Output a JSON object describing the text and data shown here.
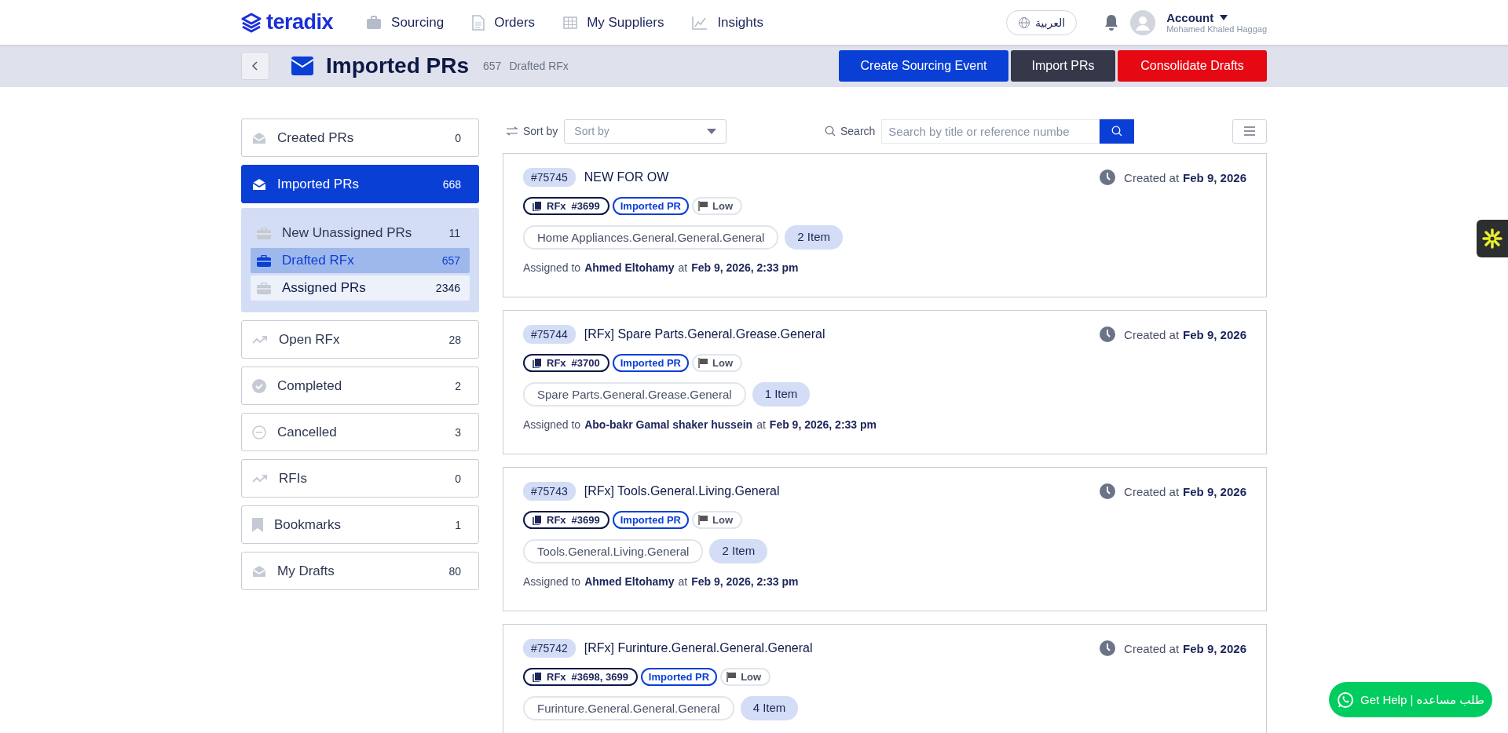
{
  "header": {
    "logo": "teradix",
    "nav": [
      {
        "kind": "briefcase",
        "label": "Sourcing"
      },
      {
        "kind": "document",
        "label": "Orders"
      },
      {
        "kind": "grid",
        "label": "My Suppliers"
      },
      {
        "kind": "chart",
        "label": "Insights"
      }
    ],
    "language": "العربية",
    "account": {
      "label": "Account",
      "name": "Mohamed Khaled Haggag"
    }
  },
  "page": {
    "title": "Imported PRs",
    "count": "657",
    "subtitle": "Drafted RFx",
    "actions": [
      {
        "kind": "primary",
        "label": "Create Sourcing Event"
      },
      {
        "kind": "dark",
        "label": "Import PRs"
      },
      {
        "kind": "danger",
        "label": "Consolidate Drafts"
      }
    ]
  },
  "sidebar": {
    "items": [
      {
        "kind": "inbox",
        "label": "Created PRs",
        "count": "0",
        "selected": false
      },
      {
        "kind": "inbox",
        "label": "Imported PRs",
        "count": "668",
        "selected": true,
        "expanded": true,
        "children": [
          {
            "label": "New Unassigned PRs",
            "count": "11",
            "selected": false,
            "hovered": false
          },
          {
            "label": "Drafted RFx",
            "count": "657",
            "selected": true,
            "hovered": false
          },
          {
            "label": "Assigned PRs",
            "count": "2346",
            "selected": false,
            "hovered": true
          }
        ]
      },
      {
        "kind": "trend",
        "label": "Open RFx",
        "count": "28",
        "selected": false
      },
      {
        "kind": "check",
        "label": "Completed",
        "count": "2",
        "selected": false
      },
      {
        "kind": "cancel",
        "label": "Cancelled",
        "count": "3",
        "selected": false
      },
      {
        "kind": "trend",
        "label": "RFIs",
        "count": "0",
        "selected": false
      },
      {
        "kind": "bookmark",
        "label": "Bookmarks",
        "count": "1",
        "selected": false
      },
      {
        "kind": "inbox",
        "label": "My Drafts",
        "count": "80",
        "selected": false
      }
    ]
  },
  "toolbar": {
    "sort_label": "Sort by",
    "sort_placeholder": "Sort by",
    "search_label": "Search",
    "search_placeholder": "Search by title or reference numbe"
  },
  "cards": [
    {
      "id": "#75745",
      "title": "NEW FOR OW",
      "rfx_label": "RFx",
      "rfx": "#3699",
      "tag": "Imported PR",
      "priority": "Low",
      "category": "Home Appliances.General.General.General",
      "items": "2 Item",
      "assigned_label": "Assigned to",
      "assignee": "Ahmed Eltohamy",
      "at": "at",
      "assigned_time": "Feb 9, 2026, 2:33 pm",
      "created_label": "Created at",
      "created_date": "Feb 9, 2026"
    },
    {
      "id": "#75744",
      "title": "[RFx] Spare Parts.General.Grease.General",
      "rfx_label": "RFx",
      "rfx": "#3700",
      "tag": "Imported PR",
      "priority": "Low",
      "category": "Spare Parts.General.Grease.General",
      "items": "1 Item",
      "assigned_label": "Assigned to",
      "assignee": "Abo-bakr Gamal shaker hussein",
      "at": "at",
      "assigned_time": "Feb 9, 2026, 2:33 pm",
      "created_label": "Created at",
      "created_date": "Feb 9, 2026"
    },
    {
      "id": "#75743",
      "title": "[RFx] Tools.General.Living.General",
      "rfx_label": "RFx",
      "rfx": "#3699",
      "tag": "Imported PR",
      "priority": "Low",
      "category": "Tools.General.Living.General",
      "items": "2 Item",
      "assigned_label": "Assigned to",
      "assignee": "Ahmed Eltohamy",
      "at": "at",
      "assigned_time": "Feb 9, 2026, 2:33 pm",
      "created_label": "Created at",
      "created_date": "Feb 9, 2026"
    },
    {
      "id": "#75742",
      "title": "[RFx] Furinture.General.General.General",
      "rfx_label": "RFx",
      "rfx": "#3698, 3699",
      "tag": "Imported PR",
      "priority": "Low",
      "category": "Furinture.General.General.General",
      "items": "4 Item",
      "created_label": "Created at",
      "created_date": "Feb 9, 2026"
    }
  ],
  "help": {
    "label": "Get Help | طلب مساعده"
  }
}
